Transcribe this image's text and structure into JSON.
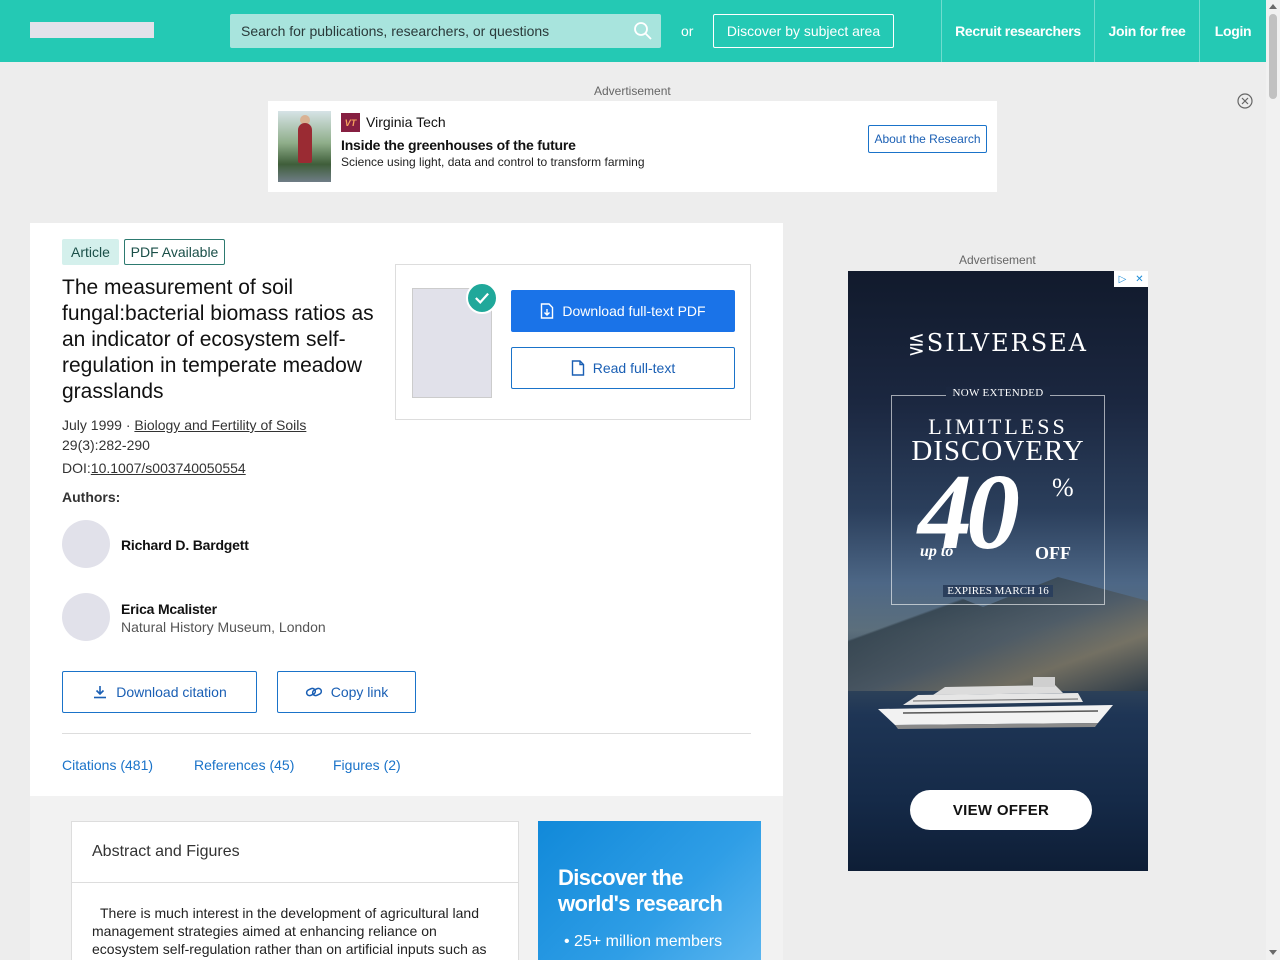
{
  "header": {
    "search_placeholder": "Search for publications, researchers, or questions",
    "or_text": "or",
    "discover_label": "Discover by subject area",
    "recruit_label": "Recruit researchers",
    "join_label": "Join for free",
    "login_label": "Login",
    "brand_color": "#24c9b4"
  },
  "top_ad": {
    "label": "Advertisement",
    "logo_text": "VT",
    "brand": "Virginia Tech",
    "headline": "Inside the greenhouses of the future",
    "subline": "Science using light, data and control to transform farming",
    "cta": "About the Research"
  },
  "article": {
    "type_badge": "Article",
    "pdf_badge": "PDF Available",
    "title": "The measurement of soil fungal:bacterial biomass ratios as an indicator of ecosystem self-regulation in temperate meadow grasslands",
    "date": "July 1999",
    "separator": " · ",
    "journal": "Biology and Fertility of Soils",
    "volume": "29(3):282-290",
    "doi_label": "DOI:",
    "doi": "10.1007/s003740050554",
    "authors_label": "Authors:",
    "authors": [
      {
        "name": "Richard D. Bardgett",
        "affiliation": ""
      },
      {
        "name": "Erica Mcalister",
        "affiliation": "Natural History Museum, London"
      }
    ],
    "download_citation": "Download citation",
    "copy_link": "Copy link",
    "tabs": [
      "Citations (481)",
      "References (45)",
      "Figures (2)"
    ]
  },
  "pdf_box": {
    "download_label": "Download full-text PDF",
    "read_label": "Read full-text"
  },
  "abstract": {
    "heading": "Abstract and Figures",
    "text": "There is much interest in the development of agricultural land management strategies aimed at enhancing reliance on ecosystem self-regulation rather than on artificial inputs such as"
  },
  "promo": {
    "title": "Discover the world's research",
    "item1": "25+ million members"
  },
  "side_ad": {
    "label": "Advertisement",
    "brand": "SILVERSEA",
    "now_extended": "NOW EXTENDED",
    "line1": "LIMITLESS",
    "line2": "DISCOVERY",
    "up_to": "up to",
    "amount": "40",
    "percent": "%",
    "off": "OFF",
    "expires": "EXPIRES MARCH 16",
    "cta": "VIEW OFFER"
  }
}
